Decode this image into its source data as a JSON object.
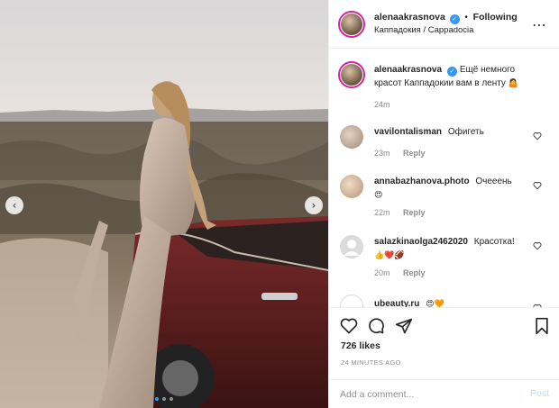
{
  "post": {
    "username": "alenaakrasnova",
    "follow_separator": "•",
    "follow_status": "Following",
    "location": "Каппадокия / Cappadocia",
    "more_icon": "more-horizontal-icon"
  },
  "caption": {
    "username": "alenaakrasnova",
    "text": "Ещё немного красот Каппадокии вам в ленту",
    "emoji": "🤷",
    "time": "24m"
  },
  "comments": [
    {
      "username": "vavilontalisman",
      "text": "Офигеть",
      "time": "23m",
      "reply": "Reply"
    },
    {
      "username": "annabazhanova.photo",
      "text": "Очееень",
      "emoji": "😍",
      "time": "22m",
      "reply": "Reply"
    },
    {
      "username": "salazkinaolga2462020",
      "text": "Красотка!",
      "emoji": "👍❤️🏈",
      "time": "20m",
      "reply": "Reply"
    },
    {
      "username": "ubeauty.ru",
      "text": "",
      "emoji": "😍🧡"
    }
  ],
  "actions": {
    "likes": "726 likes",
    "time_ago": "24 MINUTES AGO"
  },
  "add_comment": {
    "placeholder": "Add a comment...",
    "post_label": "Post"
  },
  "carousel": {
    "prev": "‹",
    "next": "›",
    "total_slides": 3,
    "active_slide": 1
  },
  "colors": {
    "verified": "#3897f0",
    "accent": "#3897f0",
    "post_disabled": "#b2dffc",
    "story_ring": "#d6249f"
  }
}
